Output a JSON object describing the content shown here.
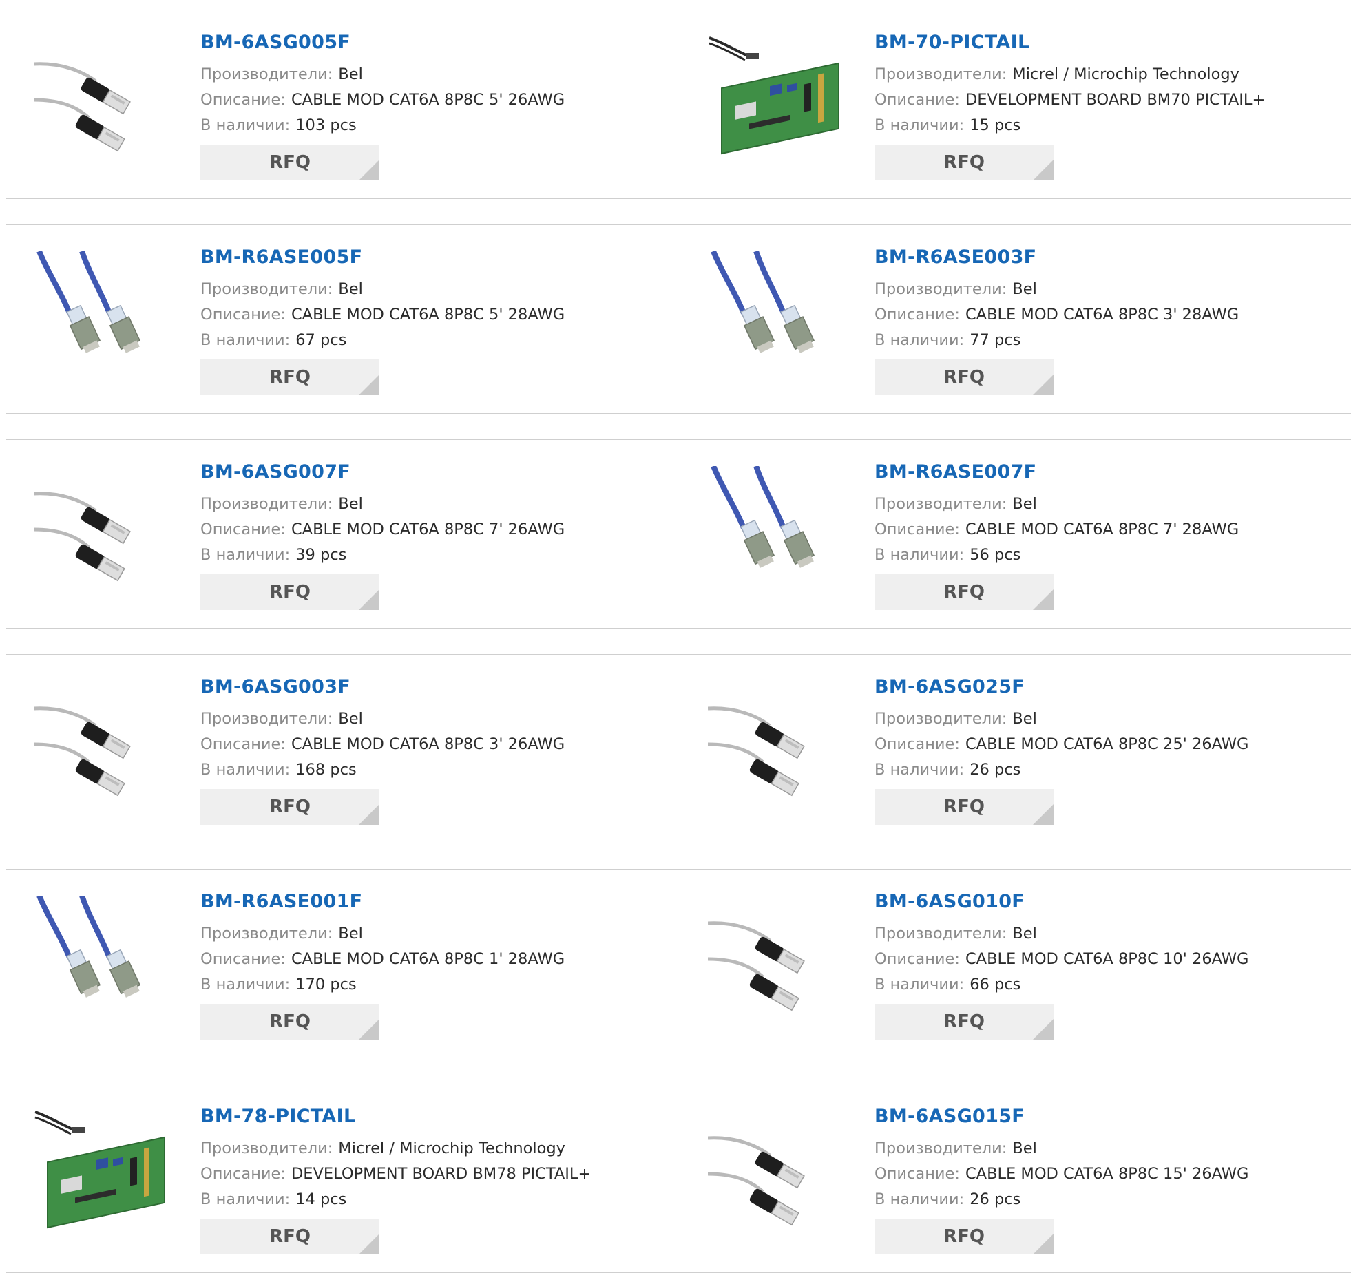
{
  "labels": {
    "manufacturer": "Производители:",
    "description": "Описание:",
    "stock": "В наличии:",
    "rfq": "RFQ"
  },
  "colors": {
    "link": "#1767b5",
    "label": "#8a8a8a",
    "button_bg": "#efefef",
    "border": "#cfcfcf"
  },
  "products": [
    {
      "part": "BM-6ASG005F",
      "manufacturer": "Bel",
      "description": "CABLE MOD CAT6A 8P8C 5' 26AWG",
      "stock": "103 pcs",
      "image": "gray-cat6-cable-icon"
    },
    {
      "part": "BM-70-PICTAIL",
      "manufacturer": "Micrel / Microchip Technology",
      "description": "DEVELOPMENT BOARD BM70 PICTAIL+",
      "stock": "15 pcs",
      "image": "dev-board-icon"
    },
    {
      "part": "BM-R6ASE005F",
      "manufacturer": "Bel",
      "description": "CABLE MOD CAT6A 8P8C 5' 28AWG",
      "stock": "67 pcs",
      "image": "blue-cat6-cable-icon"
    },
    {
      "part": "BM-R6ASE003F",
      "manufacturer": "Bel",
      "description": "CABLE MOD CAT6A 8P8C 3' 28AWG",
      "stock": "77 pcs",
      "image": "blue-cat6-cable-icon"
    },
    {
      "part": "BM-6ASG007F",
      "manufacturer": "Bel",
      "description": "CABLE MOD CAT6A 8P8C 7' 26AWG",
      "stock": "39 pcs",
      "image": "gray-cat6-cable-icon"
    },
    {
      "part": "BM-R6ASE007F",
      "manufacturer": "Bel",
      "description": "CABLE MOD CAT6A 8P8C 7' 28AWG",
      "stock": "56 pcs",
      "image": "blue-cat6-cable-icon"
    },
    {
      "part": "BM-6ASG003F",
      "manufacturer": "Bel",
      "description": "CABLE MOD CAT6A 8P8C 3' 26AWG",
      "stock": "168 pcs",
      "image": "gray-cat6-cable-icon"
    },
    {
      "part": "BM-6ASG025F",
      "manufacturer": "Bel",
      "description": "CABLE MOD CAT6A 8P8C 25' 26AWG",
      "stock": "26 pcs",
      "image": "gray-cat6-cable-icon"
    },
    {
      "part": "BM-R6ASE001F",
      "manufacturer": "Bel",
      "description": "CABLE MOD CAT6A 8P8C 1' 28AWG",
      "stock": "170 pcs",
      "image": "blue-cat6-cable-icon"
    },
    {
      "part": "BM-6ASG010F",
      "manufacturer": "Bel",
      "description": "CABLE MOD CAT6A 8P8C 10' 26AWG",
      "stock": "66 pcs",
      "image": "gray-cat6-cable-icon"
    },
    {
      "part": "BM-78-PICTAIL",
      "manufacturer": "Micrel / Microchip Technology",
      "description": "DEVELOPMENT BOARD BM78 PICTAIL+",
      "stock": "14 pcs",
      "image": "dev-board-icon"
    },
    {
      "part": "BM-6ASG015F",
      "manufacturer": "Bel",
      "description": "CABLE MOD CAT6A 8P8C 15' 26AWG",
      "stock": "26 pcs",
      "image": "gray-cat6-cable-icon"
    }
  ]
}
